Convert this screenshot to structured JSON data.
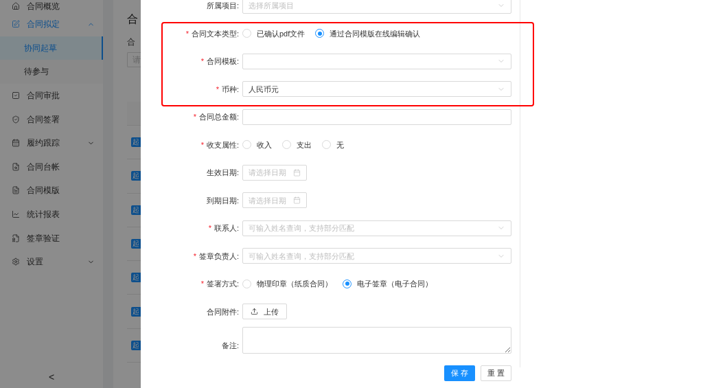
{
  "sidebar": {
    "items": [
      {
        "label": "合同概览",
        "selected": false
      },
      {
        "label": "合同拟定",
        "selected": true,
        "expanded": true,
        "children": [
          {
            "label": "协同起草",
            "selected": true
          },
          {
            "label": "待参与",
            "selected": false
          }
        ]
      },
      {
        "label": "合同审批",
        "selected": false
      },
      {
        "label": "合同签署",
        "selected": false
      },
      {
        "label": "履约跟踪",
        "selected": false,
        "expanded": false
      },
      {
        "label": "合同台帐",
        "selected": false
      },
      {
        "label": "合同模版",
        "selected": false
      },
      {
        "label": "统计报表",
        "selected": false
      },
      {
        "label": "签章验证",
        "selected": false
      },
      {
        "label": "设置",
        "selected": false,
        "expanded": false
      }
    ],
    "collapse_button": "<"
  },
  "background_page": {
    "title": "合",
    "filter_label": "合",
    "filter_placeholder": "请",
    "row_tags": [
      "起",
      "起",
      "起",
      "起",
      "起",
      "起",
      "起"
    ]
  },
  "drawer": {
    "form": [
      {
        "kind": "select",
        "label": "所属项目:",
        "placeholder": "选择所属项目"
      },
      {
        "kind": "radio",
        "label": "合同文本类型:",
        "required_mark": "*",
        "options": [
          {
            "label": "已确认pdf文件",
            "selected": false
          },
          {
            "label": "通过合同模版在线编辑确认",
            "selected": true
          }
        ]
      },
      {
        "kind": "select",
        "label": "合同模板:",
        "required_mark": "*"
      },
      {
        "kind": "select",
        "label": "币种:",
        "required_mark": "*",
        "value": "人民币元"
      },
      {
        "kind": "input",
        "label": "合同总金额:",
        "required_mark": "*"
      },
      {
        "kind": "radio",
        "label": "收支属性:",
        "required_mark": "*",
        "options": [
          {
            "label": "收入",
            "selected": false
          },
          {
            "label": "支出",
            "selected": false
          },
          {
            "label": "无",
            "selected": false
          }
        ]
      },
      {
        "kind": "date",
        "label": "生效日期:",
        "placeholder": "请选择日期"
      },
      {
        "kind": "date",
        "label": "到期日期:",
        "placeholder": "请选择日期"
      },
      {
        "kind": "select",
        "label": "联系人:",
        "required_mark": "*",
        "placeholder": "可输入姓名查询，支持部分匹配"
      },
      {
        "kind": "select",
        "label": "签章负责人:",
        "required_mark": "*",
        "placeholder": "可输入姓名查询，支持部分匹配"
      },
      {
        "kind": "radio",
        "label": "签署方式:",
        "required_mark": "*",
        "options": [
          {
            "label": "物理印章（纸质合同）",
            "selected": false
          },
          {
            "label": "电子签章（电子合同）",
            "selected": true
          }
        ]
      },
      {
        "kind": "upload",
        "label": "合同附件:",
        "button": "上传"
      },
      {
        "kind": "textarea",
        "label": "备注:"
      }
    ],
    "buttons": [
      {
        "label": "保 存",
        "kind": "primary"
      },
      {
        "label": "重 置",
        "kind": "default"
      }
    ]
  }
}
